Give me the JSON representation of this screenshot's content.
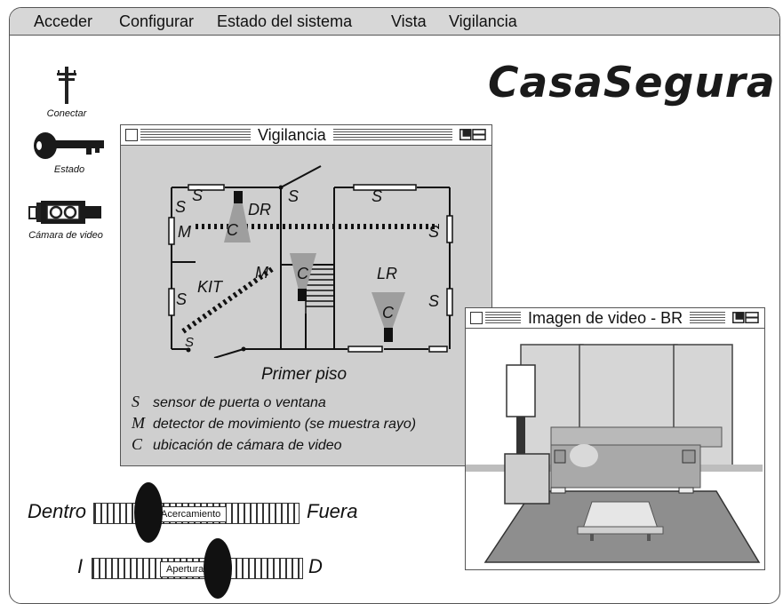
{
  "menu": {
    "items": [
      "Acceder",
      "Configurar",
      "Estado del sistema",
      "Vista",
      "Vigilancia"
    ]
  },
  "logo": {
    "text": "CasaSegura"
  },
  "sidebar": {
    "connect": {
      "label": "Conectar",
      "icon": "telephone-pole-icon"
    },
    "status": {
      "label": "Estado",
      "icon": "key-icon"
    },
    "camera": {
      "label": "Cámara de video",
      "icon": "video-camera-icon"
    }
  },
  "surveillance_window": {
    "title": "Vigilancia",
    "floor_title": "Primer piso",
    "rooms": {
      "dr": "DR",
      "kit": "KIT",
      "lr": "LR"
    },
    "symbols": {
      "sensor": "S",
      "motion": "M",
      "camera": "C"
    },
    "legend": [
      {
        "symbol": "S",
        "text": "sensor de puerta o ventana"
      },
      {
        "symbol": "M",
        "text": "detector de movimiento (se muestra rayo)"
      },
      {
        "symbol": "C",
        "text": "ubicación de cámara de video"
      }
    ]
  },
  "video_window": {
    "title": "Imagen de video - BR"
  },
  "zoom_slider": {
    "left_label": "Dentro",
    "track_label": "Acercamiento",
    "right_label": "Fuera",
    "value": 0.27
  },
  "pan_slider": {
    "left_label": "I",
    "track_label": "Apertura",
    "right_label": "D",
    "value": 0.6
  },
  "colors": {
    "menubar": "#d7d7d7",
    "window_body": "#cfcfcf",
    "ink": "#111111"
  }
}
